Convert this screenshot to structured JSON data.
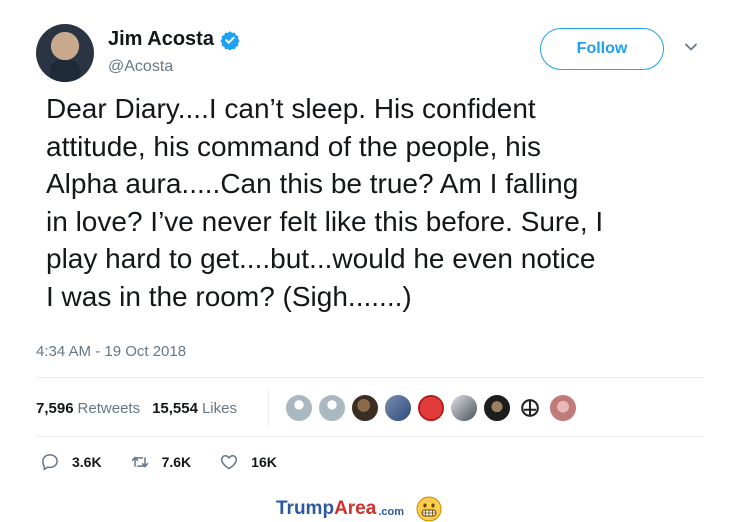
{
  "author": {
    "display_name": "Jim Acosta",
    "handle": "@Acosta",
    "verified": true
  },
  "follow_button": {
    "label": "Follow"
  },
  "tweet": {
    "lines": [
      "Dear Diary....I can’t sleep. His confident",
      "attitude, his command of the people, his",
      "Alpha aura.....Can this be true? Am I falling",
      "in love? I’ve never felt like this before. Sure, I",
      "play hard to get....but...would he even notice",
      "I was in the room? (Sigh.......)"
    ],
    "timestamp": "4:34 AM - 19 Oct 2018"
  },
  "stats": {
    "retweets_count": "7,596",
    "retweets_label": "Retweets",
    "likes_count": "15,554",
    "likes_label": "Likes"
  },
  "actions": {
    "reply_count": "3.6K",
    "retweet_count": "7.6K",
    "like_count": "16K"
  },
  "watermark": {
    "part1": "Trump",
    "part2": "Area",
    "part3": ".com"
  },
  "colors": {
    "accent": "#1da1f2",
    "secondary_text": "#657786",
    "divider": "#e6ecf0"
  },
  "icons": [
    "verified-badge-icon",
    "chevron-down-icon",
    "reply-icon",
    "retweet-icon",
    "heart-icon",
    "grimace-emoji-icon"
  ]
}
